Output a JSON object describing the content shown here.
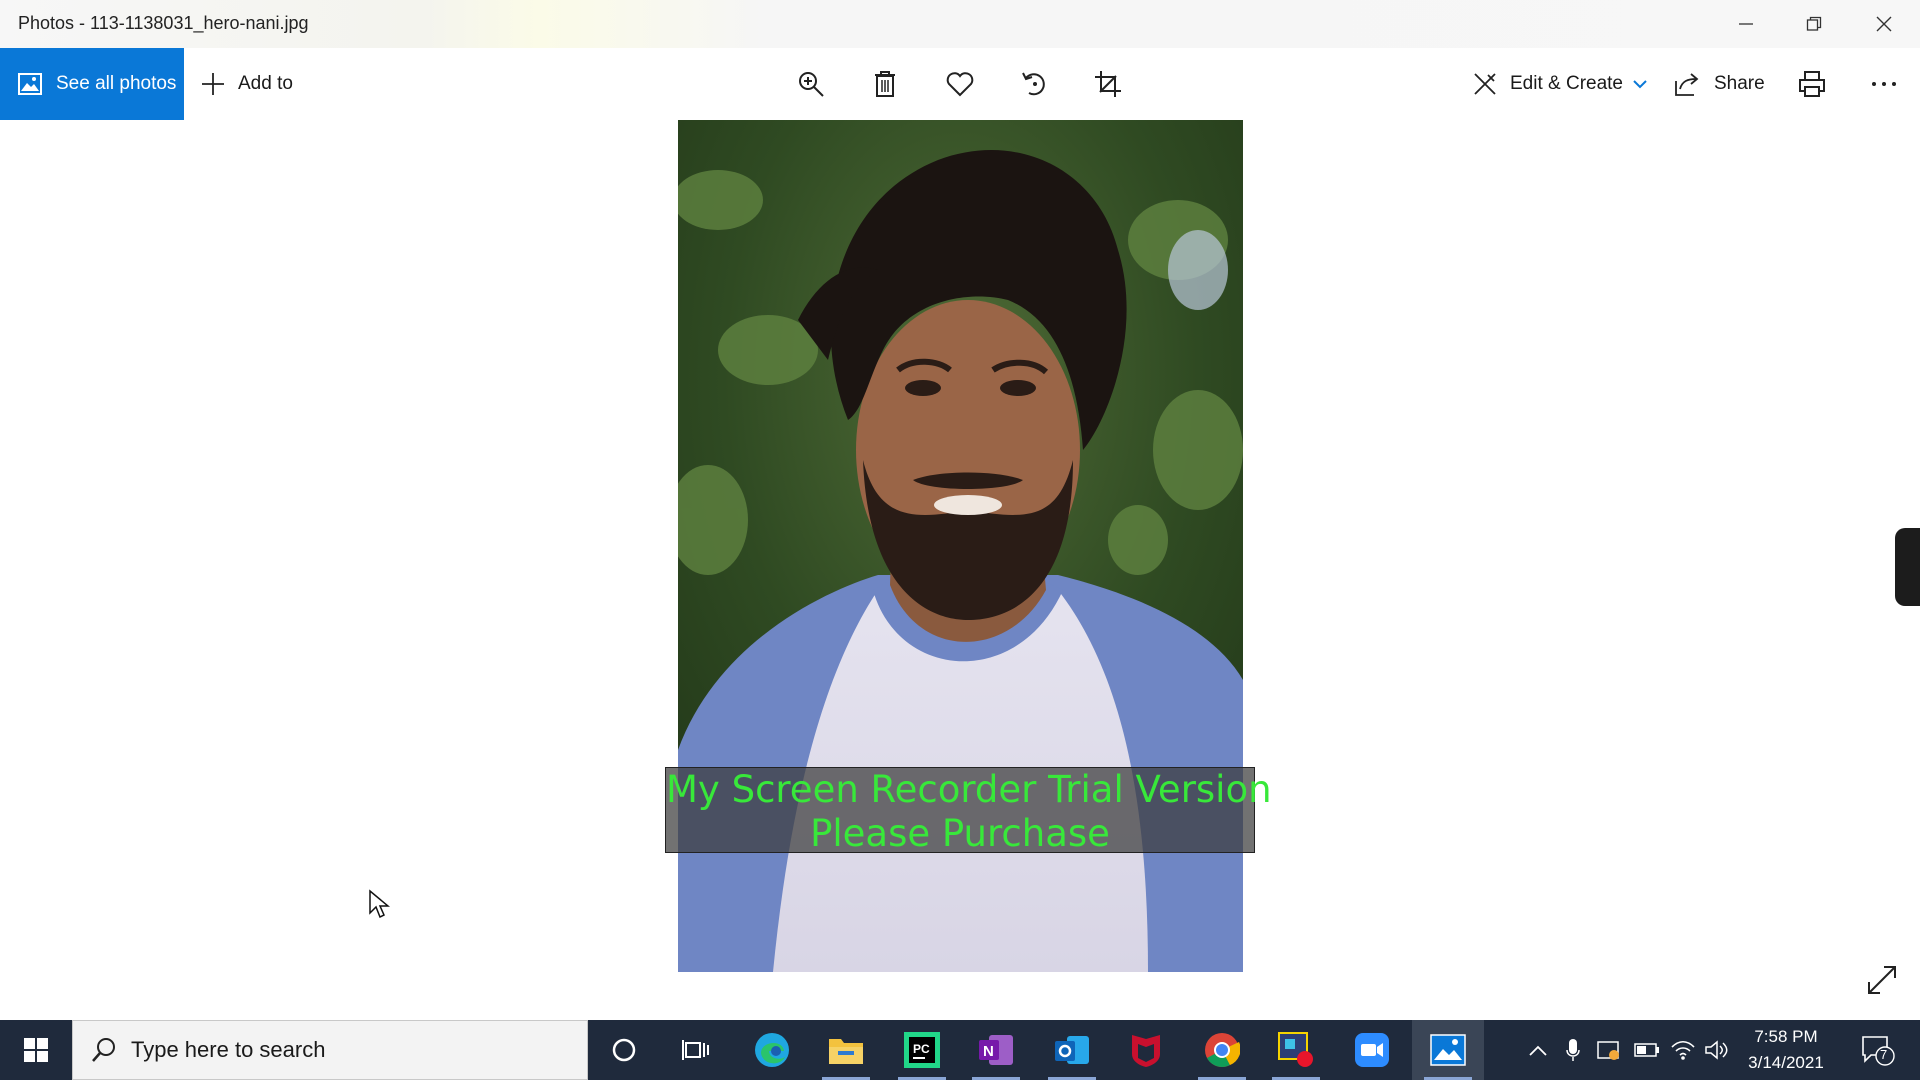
{
  "window": {
    "title": "Photos - 113-1138031_hero-nani.jpg",
    "controls": [
      "minimize-icon",
      "restore-icon",
      "close-icon"
    ]
  },
  "toolbar": {
    "see_all_label": "See all photos",
    "add_to_label": "Add to",
    "center_icons": [
      "zoom-in-icon",
      "delete-icon",
      "favorite-icon",
      "rotate-icon",
      "crop-icon"
    ],
    "edit_create_label": "Edit & Create",
    "share_label": "Share",
    "print_icon": "print-icon",
    "more_icon": "more-icon",
    "accent": "#0a78d7"
  },
  "viewer": {
    "watermark_line1": "My Screen Recorder Trial Version",
    "watermark_line2": "Please Purchase",
    "watermark_color": "#38e83a"
  },
  "taskbar": {
    "search_placeholder": "Type here to search",
    "apps": [
      "cortana-icon",
      "task-view-icon",
      "edge-icon",
      "file-explorer-icon",
      "pycharm-icon",
      "onenote-icon",
      "outlook-icon",
      "mcafee-icon",
      "chrome-icon",
      "screen-recorder-icon",
      "zoom-icon",
      "photos-icon"
    ],
    "time": "7:58 PM",
    "date": "3/14/2021",
    "notification_count": "7"
  }
}
